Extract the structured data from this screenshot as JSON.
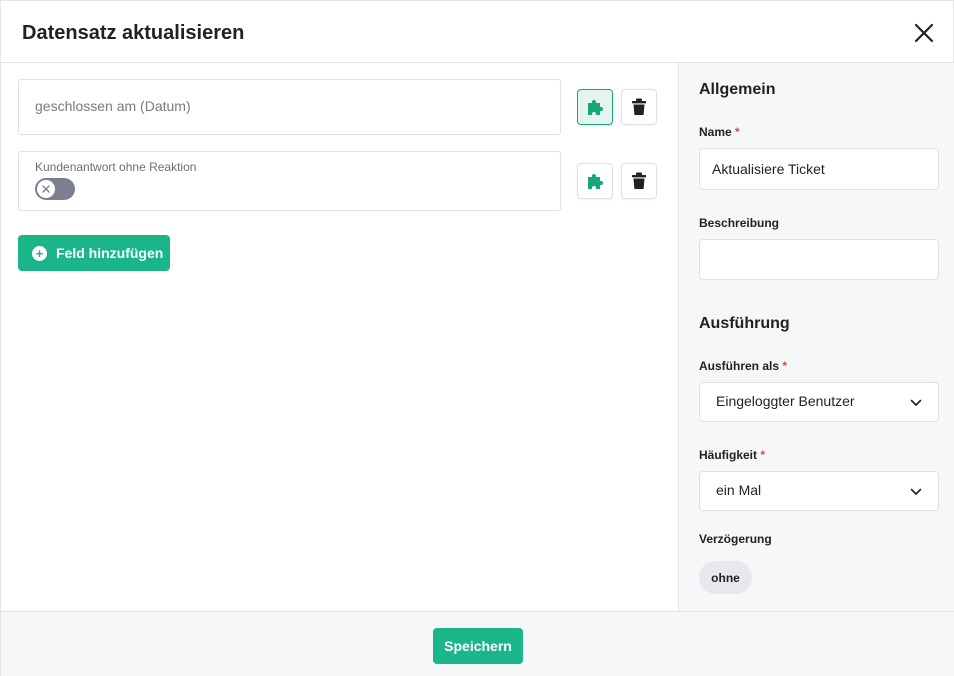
{
  "dialog": {
    "title": "Datensatz aktualisieren"
  },
  "fields": [
    {
      "placeholder": "geschlossen am (Datum)"
    },
    {
      "label": "Kundenantwort ohne Reaktion",
      "toggle_value": false
    }
  ],
  "add_field_label": "Feld hinzufügen",
  "sidebar": {
    "general_title": "Allgemein",
    "name_label": "Name",
    "name_value": "Aktualisiere Ticket",
    "description_label": "Beschreibung",
    "description_value": "",
    "execution_title": "Ausführung",
    "run_as_label": "Ausführen als",
    "run_as_value": "Eingeloggter Benutzer",
    "frequency_label": "Häufigkeit",
    "frequency_value": "ein Mal",
    "delay_label": "Verzögerung",
    "delay_value": "ohne",
    "required_mark": "*"
  },
  "footer": {
    "save_label": "Speichern"
  },
  "colors": {
    "accent": "#1ab588",
    "required": "#e0493c",
    "toggle_off": "#7c7f90"
  }
}
